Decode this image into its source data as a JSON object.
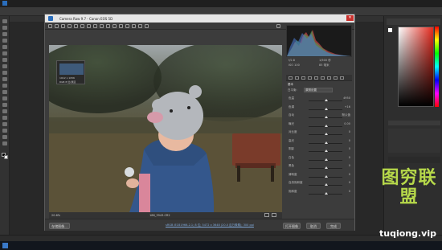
{
  "camera_raw": {
    "title": "Camera Raw 9.7 - Canon EOS 5D",
    "zoom": "20.6%",
    "file_name": "186_3943.CR2",
    "workflow_link": "sRGB IEC61966-2.1; 8 位; 5472 x 3648 (20.0 百万像素); 300 ppi",
    "buttons": {
      "save": "存储图像...",
      "open": "打开图像",
      "cancel": "取消",
      "done": "完成"
    },
    "nav_box": {
      "line1": "1912 x 1056",
      "line2": "RGB 8 位/通道"
    },
    "camera_info": {
      "f": "f/2.8",
      "shutter": "1/500 秒",
      "iso": "ISO 100",
      "focal": "85 毫米"
    },
    "panel_title": "基本",
    "white_balance_label": "白平衡:",
    "white_balance_value": "原照设置",
    "sliders": [
      {
        "label": "色温",
        "value": "4950"
      },
      {
        "label": "色调",
        "value": "+16"
      },
      {
        "label": "自动",
        "value": "默认值"
      },
      {
        "label": "曝光",
        "value": "0.00"
      },
      {
        "label": "对比度",
        "value": "0"
      },
      {
        "label": "高光",
        "value": "0"
      },
      {
        "label": "阴影",
        "value": "0"
      },
      {
        "label": "白色",
        "value": "0"
      },
      {
        "label": "黑色",
        "value": "0"
      },
      {
        "label": "清晰度",
        "value": "0"
      },
      {
        "label": "自然饱和度",
        "value": "0"
      },
      {
        "label": "饱和度",
        "value": "0"
      }
    ]
  },
  "watermark": {
    "title": "图穷联盟",
    "url": "tuqiong.vip"
  }
}
